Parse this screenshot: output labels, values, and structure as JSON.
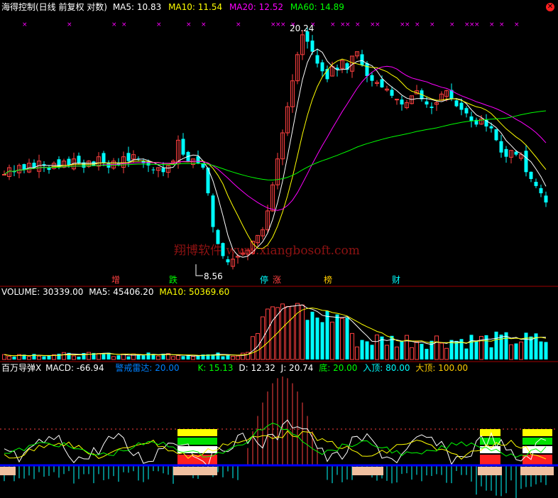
{
  "main": {
    "title": "海得控制(日线 前复权 对数)",
    "ma": [
      {
        "label": "MA5: 10.83",
        "color": "#ffffff"
      },
      {
        "label": "MA10: 11.54",
        "color": "#ffff00"
      },
      {
        "label": "MA20: 12.52",
        "color": "#ff00ff"
      },
      {
        "label": "MA60: 14.89",
        "color": "#00ff00"
      }
    ],
    "high_label": "20.24",
    "low_label": "8.56",
    "event_labels": [
      {
        "text": "增",
        "color": "#ff4040"
      },
      {
        "text": "跌",
        "color": "#00ff00"
      },
      {
        "text": "停",
        "color": "#00ffff"
      },
      {
        "text": "涨",
        "color": "#ff4040"
      },
      {
        "text": "榜",
        "color": "#ffcc00"
      },
      {
        "text": "财",
        "color": "#00ffff"
      }
    ],
    "top_markers": "×"
  },
  "watermark": "翔博软件 www.xiangbosoft.com",
  "volume": {
    "title": "VOLUME: 30339.00",
    "ma5": "MA5: 45406.20",
    "ma10": "MA10: 50369.60"
  },
  "indicator": {
    "title": "百万导弹X",
    "macd": "MACD: -66.94",
    "alert": "警戒雷达: 20.00",
    "k": "K: 15.13",
    "d": "D: 12.32",
    "j": "J: 20.74",
    "bottom": "底: 20.00",
    "entry_top": "入顶: 80.00",
    "big_top": "大顶: 100.00"
  },
  "colors": {
    "up": "#ff4040",
    "down": "#00ffff",
    "ma5": "#ffffff",
    "ma10": "#ffff00",
    "ma20": "#ff00ff",
    "ma60": "#00ff00",
    "divider": "#a00000"
  },
  "chart_data": {
    "type": "candlestick",
    "price_scale": "log",
    "price_range": [
      8.56,
      20.24
    ],
    "close": [
      12.0,
      12.3,
      12.1,
      12.4,
      12.2,
      12.5,
      12.3,
      12.6,
      12.4,
      12.2,
      12.5,
      12.3,
      12.6,
      12.4,
      12.7,
      12.5,
      12.3,
      12.6,
      12.4,
      12.8,
      12.5,
      12.3,
      12.6,
      12.4,
      12.8,
      12.6,
      12.9,
      12.7,
      12.5,
      12.4,
      12.2,
      12.3,
      12.1,
      12.4,
      12.6,
      13.6,
      12.9,
      12.6,
      12.7,
      12.5,
      12.3,
      11.2,
      9.9,
      9.3,
      8.9,
      8.7,
      8.8,
      8.9,
      9.0,
      9.1,
      9.4,
      9.6,
      9.8,
      10.5,
      11.55,
      12.7,
      13.97,
      15.37,
      16.9,
      18.6,
      20.0,
      19.5,
      18.8,
      18.0,
      17.5,
      17.0,
      17.8,
      17.6,
      18.2,
      17.6,
      18.5,
      18.8,
      17.9,
      17.2,
      16.9,
      16.8,
      16.5,
      16.4,
      16.0,
      15.8,
      15.5,
      15.6,
      16.0,
      16.3,
      15.8,
      15.5,
      15.3,
      15.6,
      16.1,
      16.3,
      15.8,
      15.4,
      15.2,
      15.0,
      14.6,
      14.4,
      14.7,
      14.3,
      14.2,
      13.6,
      13.0,
      12.8,
      13.1,
      12.9,
      12.9,
      12.1,
      11.8,
      11.5,
      11.2,
      10.83
    ]
  }
}
